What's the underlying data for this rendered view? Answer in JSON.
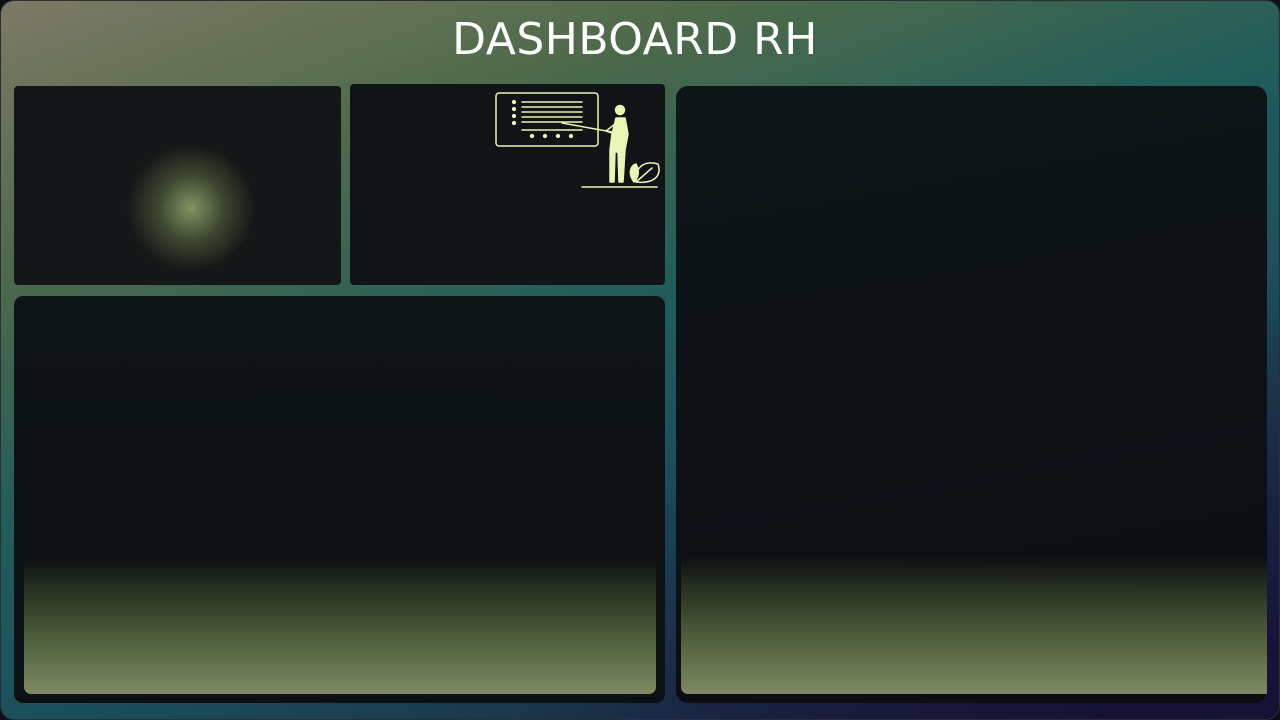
{
  "header": {
    "title": "DASHBOARD RH"
  },
  "colors": {
    "accent": "#e6f7b5",
    "panel": "#101316",
    "background_top_left": "#7d7a66",
    "background_mid": "#1f5d5b",
    "background_bottom_right": "#161838"
  },
  "icons": {
    "presentation": "presenter-with-chart-icon"
  }
}
